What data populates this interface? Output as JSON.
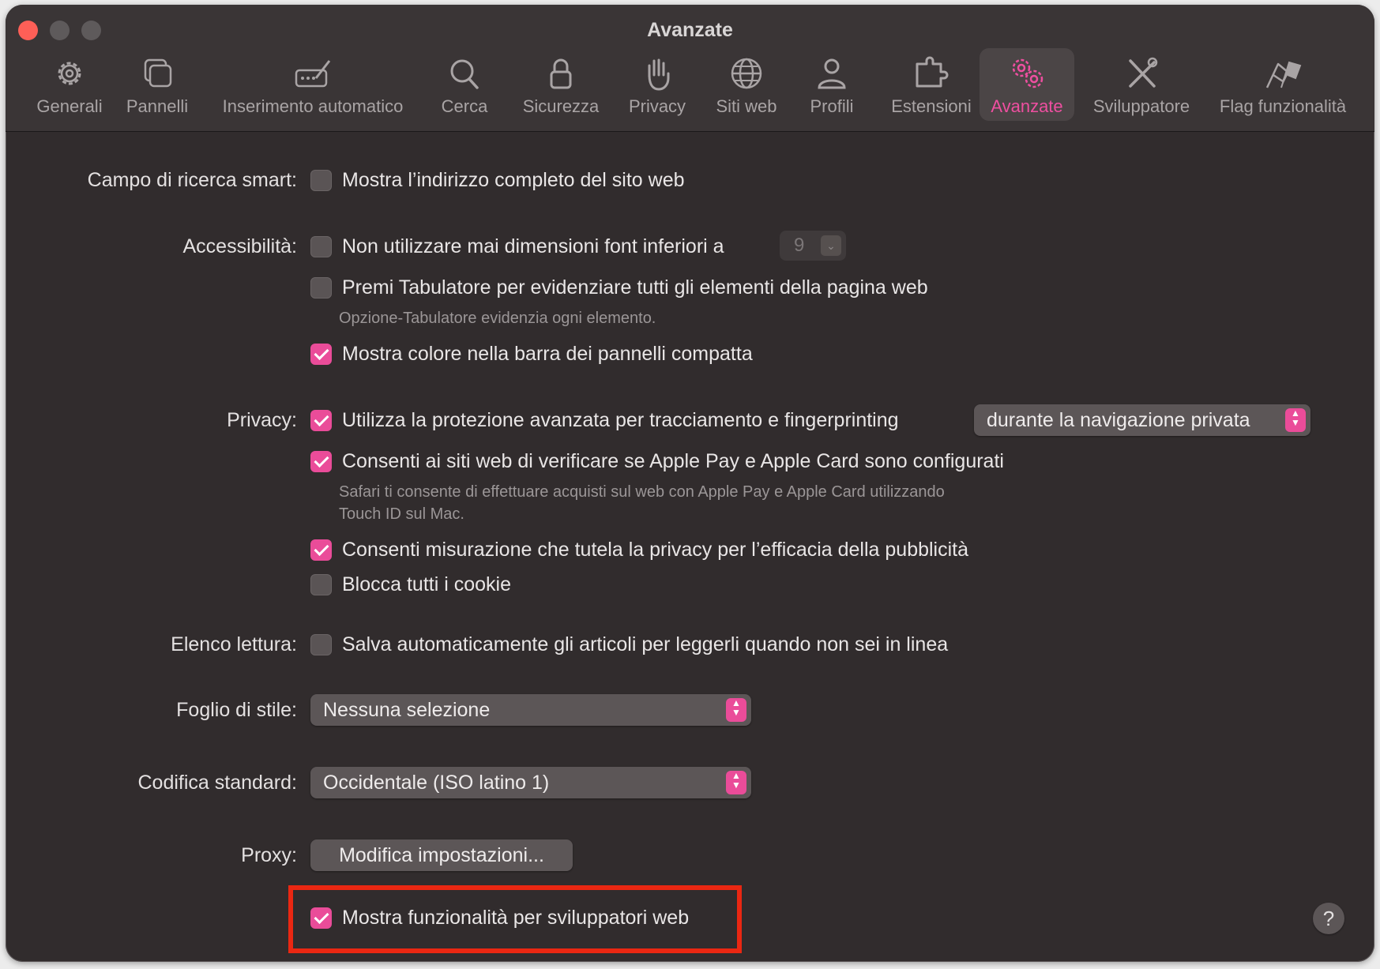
{
  "window": {
    "title": "Avanzate",
    "accent_color": "#ea4c99",
    "highlight_color": "#ea2712"
  },
  "tabs": [
    {
      "label": "Generali",
      "icon": "gear-icon"
    },
    {
      "label": "Pannelli",
      "icon": "tabs-icon"
    },
    {
      "label": "Inserimento automatico",
      "icon": "pencil-field-icon"
    },
    {
      "label": "Cerca",
      "icon": "search-icon"
    },
    {
      "label": "Sicurezza",
      "icon": "lock-icon"
    },
    {
      "label": "Privacy",
      "icon": "hand-icon"
    },
    {
      "label": "Siti web",
      "icon": "globe-icon"
    },
    {
      "label": "Profili",
      "icon": "person-icon"
    },
    {
      "label": "Estensioni",
      "icon": "puzzle-icon"
    },
    {
      "label": "Avanzate",
      "icon": "gears-icon",
      "active": true
    },
    {
      "label": "Sviluppatore",
      "icon": "tools-icon"
    },
    {
      "label": "Flag funzionalità",
      "icon": "flags-icon"
    }
  ],
  "smart_search": {
    "label": "Campo di ricerca smart:",
    "full_address": {
      "text": "Mostra l’indirizzo completo del sito web",
      "checked": false
    }
  },
  "accessibility": {
    "label": "Accessibilità:",
    "min_font": {
      "text": "Non utilizzare mai dimensioni font inferiori a",
      "checked": false,
      "value": "9"
    },
    "tab_highlight": {
      "text": "Premi Tabulatore per evidenziare tutti gli elementi della pagina web",
      "checked": false
    },
    "tab_hint": "Opzione-Tabulatore evidenzia ogni elemento.",
    "compact_color": {
      "text": "Mostra colore nella barra dei pannelli compatta",
      "checked": true
    }
  },
  "privacy": {
    "label": "Privacy:",
    "tracking": {
      "text": "Utilizza la protezione avanzata per tracciamento e fingerprinting",
      "checked": true,
      "mode": "durante la navigazione privata"
    },
    "apple_pay": {
      "text": "Consenti ai siti web di verificare se Apple Pay e Apple Card sono configurati",
      "checked": true
    },
    "apple_pay_hint_1": "Safari ti consente di effettuare acquisti sul web con Apple Pay e Apple Card utilizzando",
    "apple_pay_hint_2": "Touch ID sul Mac.",
    "ad_measurement": {
      "text": "Consenti misurazione che tutela la privacy per l’efficacia della pubblicità",
      "checked": true
    },
    "block_cookies": {
      "text": "Blocca tutti i cookie",
      "checked": false
    }
  },
  "reading_list": {
    "label": "Elenco lettura:",
    "offline": {
      "text": "Salva automaticamente gli articoli per leggerli quando non sei in linea",
      "checked": false
    }
  },
  "stylesheet": {
    "label": "Foglio di stile:",
    "value": "Nessuna selezione"
  },
  "encoding": {
    "label": "Codifica standard:",
    "value": "Occidentale (ISO latino 1)"
  },
  "proxy": {
    "label": "Proxy:",
    "button": "Modifica impostazioni..."
  },
  "developer": {
    "text": "Mostra funzionalità per sviluppatori web",
    "checked": true
  },
  "help": {
    "label": "?"
  }
}
